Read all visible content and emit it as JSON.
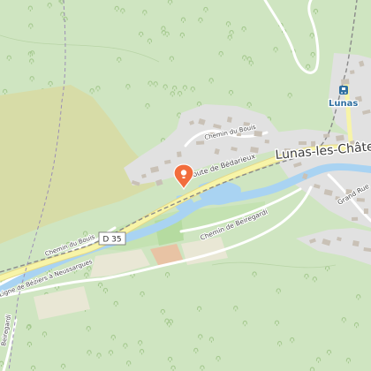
{
  "map": {
    "labels": {
      "town": "Lunas-les-Château",
      "station": "Lunas",
      "route_bedarieux": "Route de Bédarieux",
      "chemin_bouis_top": "Chemin du Bouis",
      "chemin_bouis_left": "Chemin du Bouis",
      "chemin_beiregardi": "Chemin de Beiregardi",
      "railway": "Ligne de Béziers à Neussargues",
      "grand_rue": "Grand Rue",
      "road_ref": "D 35",
      "bottom_left_road": "Beiregardi"
    },
    "colors": {
      "forest": "#cfe5c1",
      "field": "#d7dca7",
      "urban": "#e1e1e1",
      "water": "#a9d3f2",
      "road_major": "#f7f4a8",
      "road_minor": "#ffffff",
      "marker": "#f26d3d"
    },
    "icons": {
      "marker": "location-pin-icon",
      "station": "train-station-icon",
      "trees": "tree-icon"
    }
  }
}
